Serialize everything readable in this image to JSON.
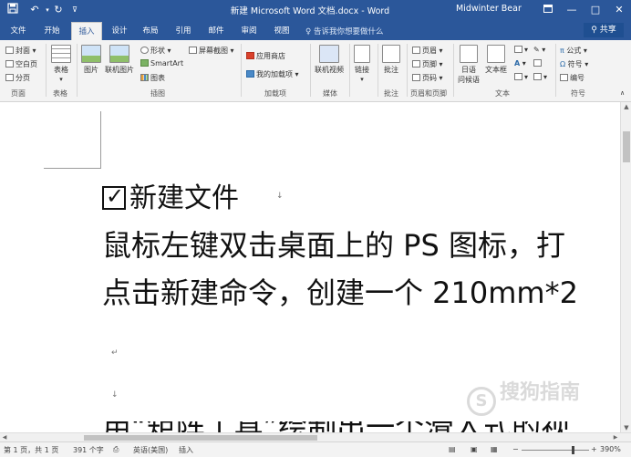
{
  "titlebar": {
    "title": "新建 Microsoft Word 文档.docx - Word",
    "user": "Midwinter Bear",
    "save_icon": "save-icon",
    "undo_icon": "undo-icon",
    "redo_icon": "redo-icon",
    "customize_icon": "customize-quick-access-icon"
  },
  "tabs": [
    {
      "label": "文件"
    },
    {
      "label": "开始"
    },
    {
      "label": "插入"
    },
    {
      "label": "设计"
    },
    {
      "label": "布局"
    },
    {
      "label": "引用"
    },
    {
      "label": "邮件"
    },
    {
      "label": "审阅"
    },
    {
      "label": "视图"
    }
  ],
  "tellme": "告诉我你想要做什么",
  "share": "共享",
  "ribbon": {
    "pages": {
      "cover": "封面",
      "blank": "空白页",
      "break": "分页",
      "group": "页面"
    },
    "tables": {
      "table": "表格",
      "group": "表格"
    },
    "illustrations": {
      "picture": "图片",
      "online_picture": "联机图片",
      "shapes": "形状",
      "smartart": "SmartArt",
      "chart": "图表",
      "screenshot": "屏幕截图",
      "group": "插图"
    },
    "addins": {
      "store": "应用商店",
      "my_addins": "我的加载项",
      "group": "加载项"
    },
    "media": {
      "online_video": "联机视频",
      "group": "媒体"
    },
    "links": {
      "link": "链接",
      "group": ""
    },
    "comments": {
      "comment": "批注",
      "group": "批注"
    },
    "header_footer": {
      "header": "页眉",
      "footer": "页脚",
      "page_number": "页码",
      "group": "页眉和页脚"
    },
    "text": {
      "greeting": "日语\n问候语",
      "greeting_line1": "日语",
      "greeting_line2": "问候语",
      "textbox": "文本框",
      "group": "文本"
    },
    "symbols": {
      "equation": "公式",
      "symbol": "符号",
      "number": "编号",
      "group": "符号"
    }
  },
  "document": {
    "heading": "新建文件",
    "line1": "鼠标左键双击桌面上的 PS 图标，打",
    "line2": "点击新建命令，创建一个 210mm*2",
    "line3_partial": "用“矩阵工具”绘制出一个滑入式的视"
  },
  "watermark": {
    "text": "搜狗指南"
  },
  "status": {
    "page": "第 1 页，共 1 页",
    "words": "391 个字",
    "language": "英语(美国)",
    "mode": "插入",
    "zoom": "390%"
  }
}
